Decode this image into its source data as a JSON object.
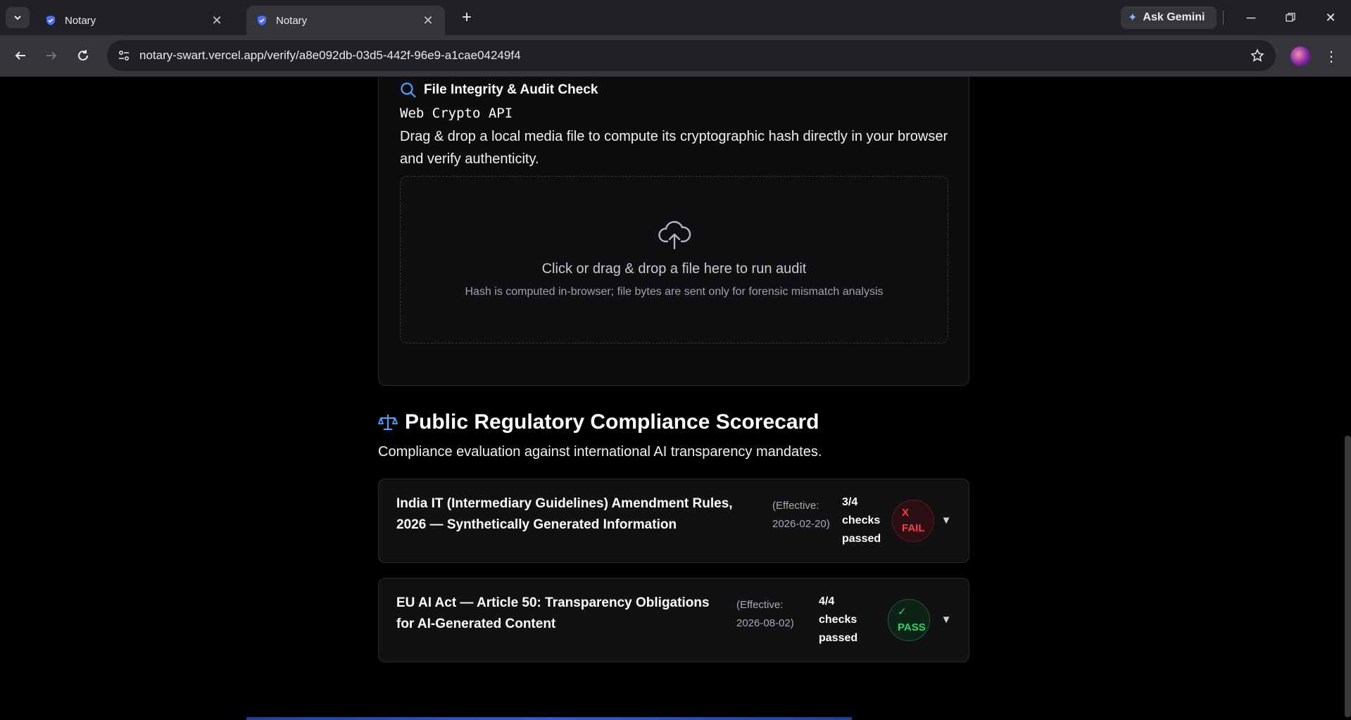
{
  "browser": {
    "tabs": [
      {
        "title": "Notary",
        "active": false
      },
      {
        "title": "Notary",
        "active": true
      }
    ],
    "gemini_label": "Ask Gemini",
    "url": "notary-swart.vercel.app/verify/a8e092db-03d5-442f-96e9-a1cae04249f4"
  },
  "audit": {
    "title": "File Integrity & Audit Check",
    "api_label": "Web Crypto API",
    "description": "Drag & drop a local media file to compute its cryptographic hash directly in your browser and verify authenticity.",
    "dropzone_text": "Click or drag & drop a file here to run audit",
    "dropzone_hint": "Hash is computed in-browser; file bytes are sent only for forensic mismatch analysis"
  },
  "scorecard": {
    "title": "Public Regulatory Compliance Scorecard",
    "subtitle": "Compliance evaluation against international AI transparency mandates.",
    "items": [
      {
        "name_line1": "India IT (Intermediary Guidelines) Amendment Rules,",
        "name_line2": "2026 — Synthetically Generated Information",
        "effective_line1": "(Effective:",
        "effective_line2": "2026-02-20)",
        "checks_line1": "3/4",
        "checks_line2": "checks",
        "checks_line3": "passed",
        "status_symbol": "X",
        "status_label": "FAIL",
        "status_color": "#ff3b4d"
      },
      {
        "name_line1": "EU AI Act — Article 50: Transparency Obligations",
        "name_line2": "for AI-Generated Content",
        "effective_line1": "(Effective:",
        "effective_line2": "2026-08-02)",
        "checks_line1": "4/4",
        "checks_line2": "checks",
        "checks_line3": "passed",
        "status_symbol": "✓",
        "status_label": "PASS",
        "status_color": "#2fd36b"
      }
    ]
  },
  "colors": {
    "accent_blue": "#4aa3ff",
    "fail_red": "#ff3b4d",
    "pass_green": "#2fd36b"
  }
}
